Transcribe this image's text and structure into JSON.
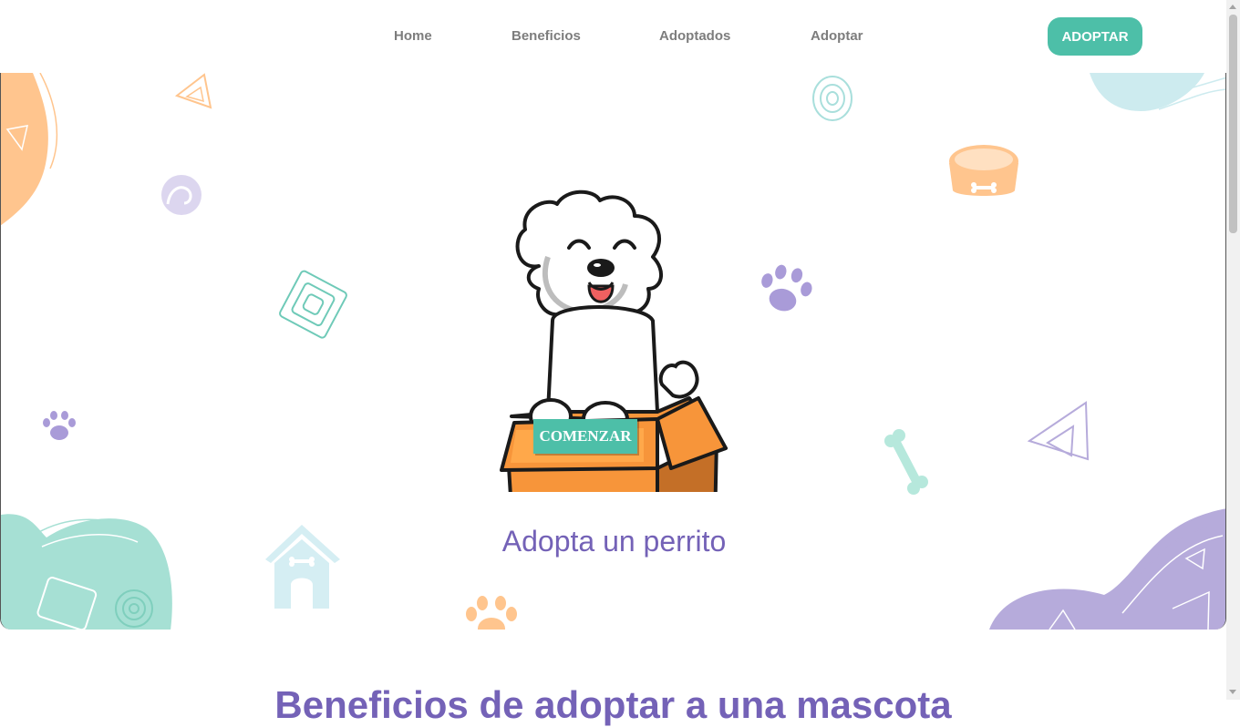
{
  "nav": {
    "links": [
      {
        "label": "Home"
      },
      {
        "label": "Beneficios"
      },
      {
        "label": "Adoptados"
      },
      {
        "label": "Adoptar"
      }
    ],
    "cta_label": "ADOPTAR"
  },
  "hero": {
    "start_label": "COMENZAR",
    "title": "Adopta un perrito"
  },
  "benefits": {
    "title": "Beneficios de adoptar a una mascota"
  },
  "colors": {
    "accent_teal": "#4dbfa8",
    "purple": "#7462b7",
    "orange": "#ffc58e",
    "mint": "#a6e0d4",
    "lavender": "#b6abdb"
  },
  "icons": [
    "paw-icon",
    "bone-icon",
    "dog-bowl-icon",
    "dog-house-icon",
    "triangle-doodle-icon",
    "spiral-doodle-icon"
  ]
}
